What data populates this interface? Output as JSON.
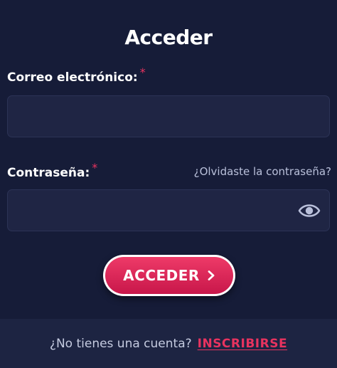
{
  "form": {
    "title": "Acceder",
    "email": {
      "label": "Correo electrónico:",
      "required_mark": "*",
      "value": "",
      "placeholder": ""
    },
    "password": {
      "label": "Contraseña:",
      "required_mark": "*",
      "value": "",
      "placeholder": "",
      "toggle_icon": "eye-icon"
    },
    "forgot_link": "¿Olvidaste la contraseña?",
    "submit_label": "ACCEDER",
    "submit_icon": "chevron-right-icon"
  },
  "footer": {
    "question": "¿No tienes una cuenta?",
    "signup_link": "INSCRIBIRSE"
  },
  "colors": {
    "background": "#161c38",
    "input_background": "#1f2544",
    "accent": "#e8335f",
    "footer_background": "#1d2442"
  }
}
